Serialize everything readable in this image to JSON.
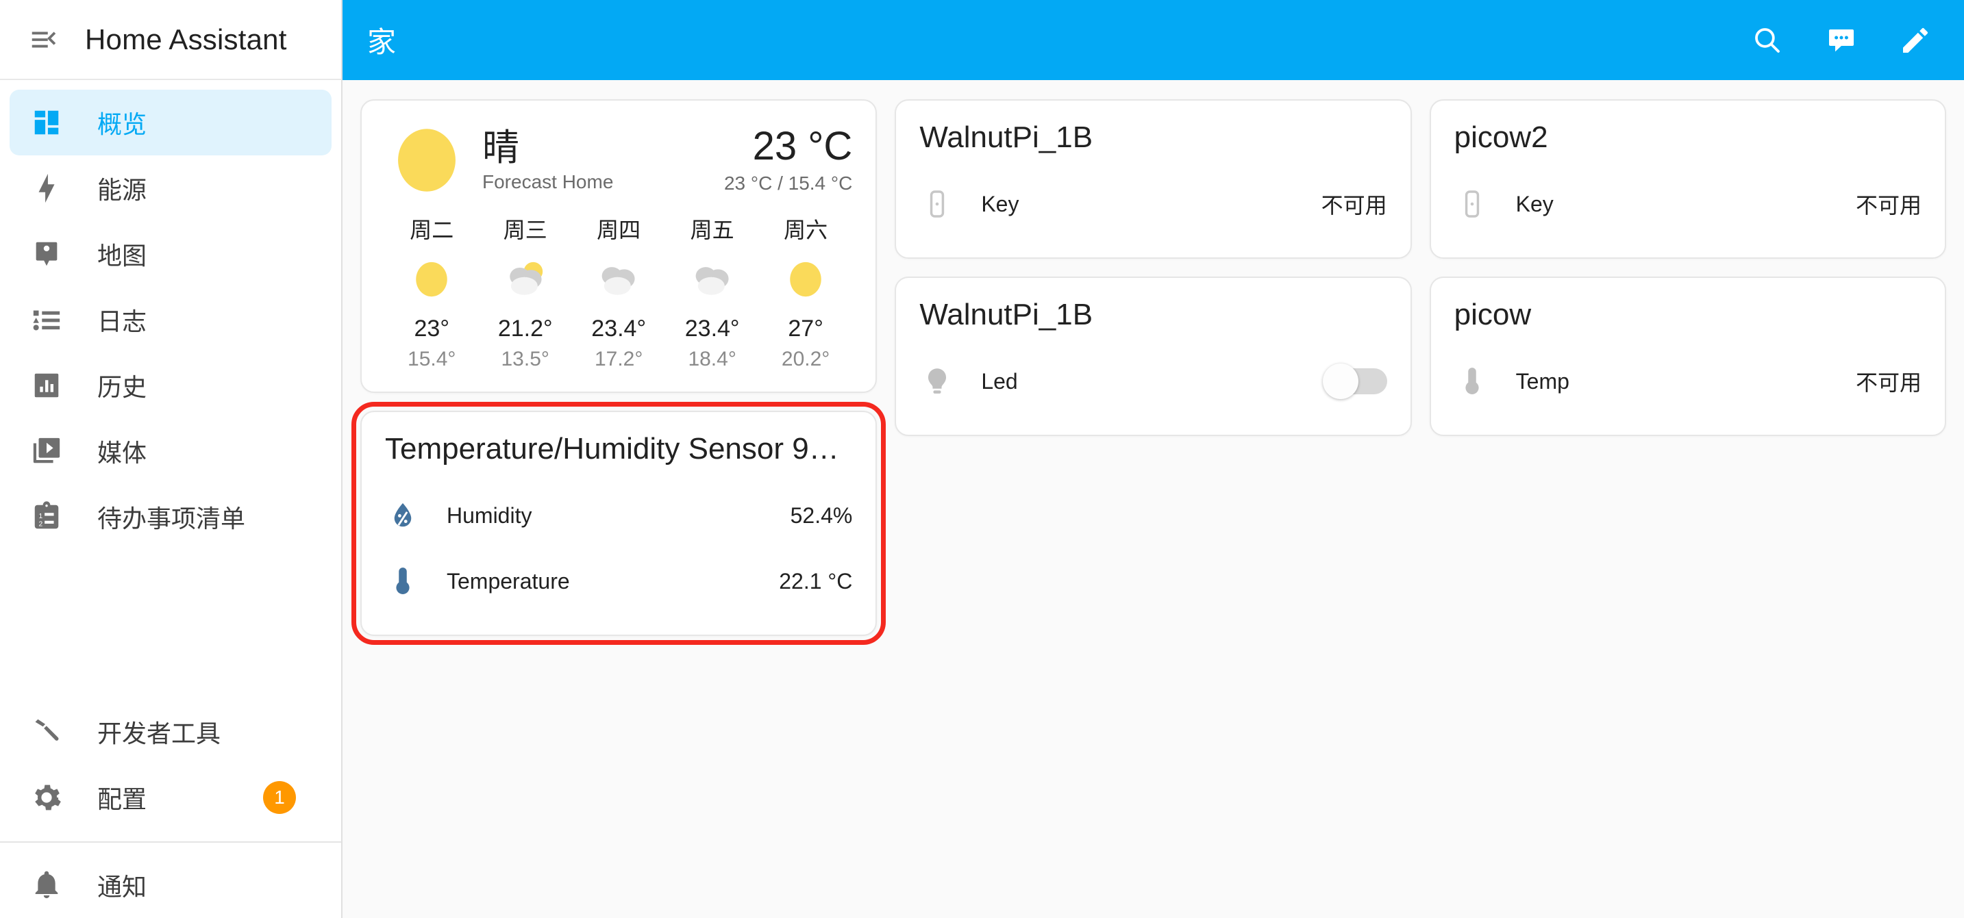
{
  "sidebar": {
    "brand_title": "Home Assistant",
    "menu_icon": "menu-collapse-icon",
    "items": [
      {
        "label": "概览",
        "icon": "view-dashboard-icon",
        "active": true
      },
      {
        "label": "能源",
        "icon": "lightning-bolt-icon",
        "active": false
      },
      {
        "label": "地图",
        "icon": "map-marker-account-icon",
        "active": false
      },
      {
        "label": "日志",
        "icon": "format-list-bulleted-icon",
        "active": false
      },
      {
        "label": "历史",
        "icon": "chart-box-icon",
        "active": false
      },
      {
        "label": "媒体",
        "icon": "play-box-multiple-icon",
        "active": false
      },
      {
        "label": "待办事项清单",
        "icon": "clipboard-list-icon",
        "active": false
      }
    ],
    "bottom_items": [
      {
        "label": "开发者工具",
        "icon": "hammer-icon",
        "badge": ""
      },
      {
        "label": "配置",
        "icon": "cog-icon",
        "badge": "1"
      }
    ],
    "notification_item": {
      "label": "通知",
      "icon": "bell-icon"
    },
    "badge_color": "#ff9800",
    "accent_color": "#03a9f4"
  },
  "toolbar": {
    "title": "家",
    "background_color": "#03a9f4",
    "actions": [
      {
        "name": "search-icon",
        "label": "搜索"
      },
      {
        "name": "assist-icon",
        "label": "Assist"
      },
      {
        "name": "edit-icon",
        "label": "编辑仪表板"
      }
    ]
  },
  "weather_card": {
    "state": "晴",
    "entity_name": "Forecast Home",
    "temperature": "23 °C",
    "range": "23 °C / 15.4 °C",
    "condition_icon": "sunny-icon",
    "forecast": [
      {
        "day": "周二",
        "icon": "sunny-icon",
        "high": "23°",
        "low": "15.4°"
      },
      {
        "day": "周三",
        "icon": "partly-cloudy-icon",
        "high": "21.2°",
        "low": "13.5°"
      },
      {
        "day": "周四",
        "icon": "cloudy-icon",
        "high": "23.4°",
        "low": "17.2°"
      },
      {
        "day": "周五",
        "icon": "cloudy-icon",
        "high": "23.4°",
        "low": "18.4°"
      },
      {
        "day": "周六",
        "icon": "sunny-icon",
        "high": "27°",
        "low": "20.2°"
      }
    ]
  },
  "sensor_card": {
    "title": "Temperature/Humidity Sensor 9…",
    "highlighted": true,
    "highlight_color": "#f4291f",
    "rows": [
      {
        "name": "Humidity",
        "icon": "water-percent-icon",
        "value": "52.4%",
        "icon_color": "#44739e"
      },
      {
        "name": "Temperature",
        "icon": "thermometer-icon",
        "value": "22.1 °C",
        "icon_color": "#44739e"
      }
    ]
  },
  "walnutpi_key_card": {
    "title": "WalnutPi_1B",
    "rows": [
      {
        "name": "Key",
        "icon": "gesture-tap-button-icon",
        "value": "不可用",
        "icon_color": "#c7c7c7"
      }
    ]
  },
  "walnutpi_led_card": {
    "title": "WalnutPi_1B",
    "rows": [
      {
        "name": "Led",
        "icon": "lightbulb-icon",
        "toggle": true,
        "toggle_on": false,
        "icon_color": "#c0c0c0"
      }
    ]
  },
  "picow2_card": {
    "title": "picow2",
    "rows": [
      {
        "name": "Key",
        "icon": "gesture-tap-button-icon",
        "value": "不可用",
        "icon_color": "#c7c7c7"
      }
    ]
  },
  "picow_card": {
    "title": "picow",
    "rows": [
      {
        "name": "Temp",
        "icon": "thermometer-icon",
        "value": "不可用",
        "icon_color": "#c0c0c0"
      }
    ]
  }
}
